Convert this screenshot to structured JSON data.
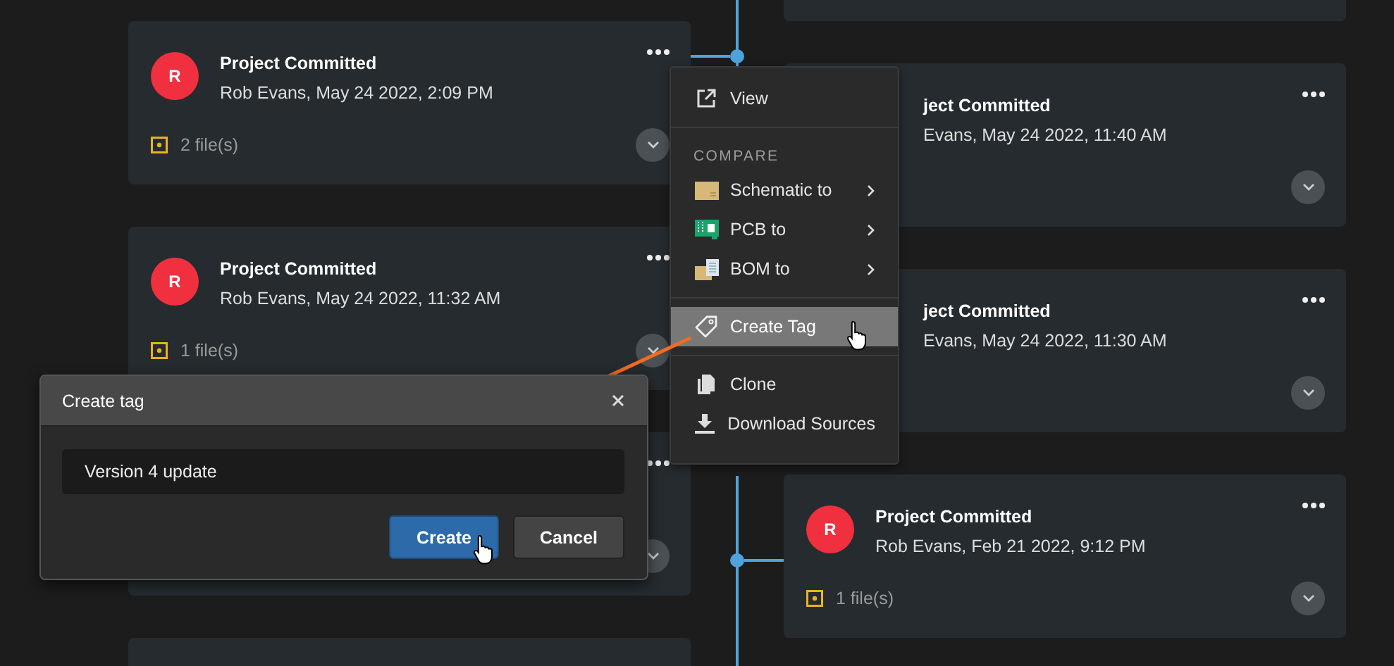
{
  "timeline": {
    "left_cards": [
      {
        "kind": "full",
        "avatar": "R",
        "title": "Project Committed",
        "subtitle": "Rob Evans, May 24 2022, 2:09 PM",
        "files": "2 file(s)"
      },
      {
        "kind": "full",
        "avatar": "R",
        "title": "Project Committed",
        "subtitle": "Rob Evans, May 24 2022, 11:32 AM",
        "files": "1 file(s)"
      },
      {
        "kind": "chrome"
      },
      {
        "kind": "bare"
      }
    ],
    "right_cards": [
      {
        "kind": "bare"
      },
      {
        "kind": "covered",
        "title": "ject Committed",
        "subtitle": "Evans, May 24 2022, 11:40 AM"
      },
      {
        "kind": "covered",
        "title": "ject Committed",
        "subtitle": "Evans, May 24 2022, 11:30 AM"
      },
      {
        "kind": "full",
        "avatar": "R",
        "title": "Project Committed",
        "subtitle": "Rob Evans, Feb 21 2022, 9:12 PM",
        "files": "1 file(s)"
      }
    ]
  },
  "context_menu": {
    "groups": [
      {
        "items": [
          {
            "label": "View",
            "submenu": false,
            "highlighted": false
          }
        ]
      },
      {
        "heading": "COMPARE",
        "items": [
          {
            "label": "Schematic to",
            "submenu": true,
            "highlighted": false
          },
          {
            "label": "PCB to",
            "submenu": true,
            "highlighted": false
          },
          {
            "label": "BOM to",
            "submenu": true,
            "highlighted": false
          }
        ]
      },
      {
        "items": [
          {
            "label": "Create Tag",
            "submenu": false,
            "highlighted": true
          }
        ]
      },
      {
        "items": [
          {
            "label": "Clone",
            "submenu": false,
            "highlighted": false
          },
          {
            "label": "Download Sources",
            "submenu": false,
            "highlighted": false
          }
        ]
      }
    ]
  },
  "dialog": {
    "title": "Create tag",
    "input": {
      "value": "Version 4 update"
    },
    "buttons": [
      {
        "label": "Create",
        "primary": true
      },
      {
        "label": "Cancel",
        "primary": false
      }
    ]
  }
}
